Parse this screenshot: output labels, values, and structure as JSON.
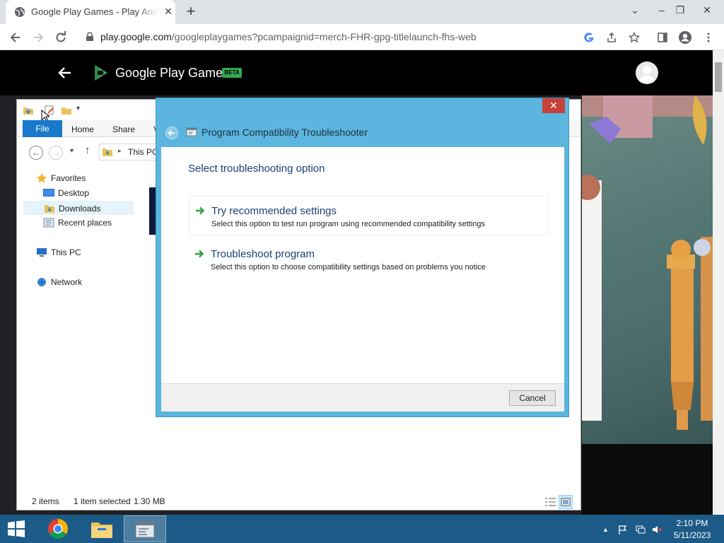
{
  "browser": {
    "tab_title": "Google Play Games - Play Android games on PC",
    "url_host": "play.google.com",
    "url_path": "/googleplaygames?pcampaignid=merch-FHR-gpg-titlelaunch-fhs-web"
  },
  "play_page": {
    "brand": "Google Play Games",
    "badge": "BETA",
    "accent": "#34a853"
  },
  "explorer": {
    "ribbon": {
      "file": "File",
      "home": "Home",
      "share": "Share",
      "view": "V"
    },
    "address": "This PC",
    "nav": {
      "favorites": "Favorites",
      "desktop": "Desktop",
      "downloads": "Downloads",
      "recent": "Recent places",
      "this_pc": "This PC",
      "network": "Network"
    },
    "status": {
      "items": "2 items",
      "selected": "1 item selected",
      "size": "1.30 MB"
    }
  },
  "dialog": {
    "title": "Program Compatibility Troubleshooter",
    "heading": "Select troubleshooting option",
    "options": [
      {
        "title": "Try recommended settings",
        "description": "Select this option to test run program using recommended compatibility settings"
      },
      {
        "title": "Troubleshoot program",
        "description": "Select this option to choose compatibility settings based on problems you notice"
      }
    ],
    "cancel": "Cancel",
    "accent": "#5bb5de"
  },
  "taskbar": {
    "time": "2:10 PM",
    "date": "5/11/2023"
  }
}
